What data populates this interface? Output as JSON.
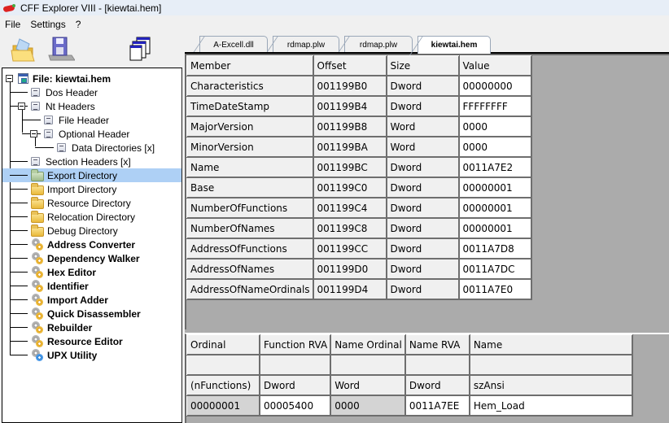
{
  "window": {
    "title": "CFF Explorer VIII - [kiewtai.hem]"
  },
  "menu": [
    "File",
    "Settings",
    "?"
  ],
  "toolbar": [
    {
      "name": "open-icon"
    },
    {
      "name": "save-icon"
    },
    {
      "name": "windows-icon"
    }
  ],
  "tree": {
    "root": "File: kiewtai.hem",
    "items": [
      {
        "label": "Dos Header",
        "icon": "doc",
        "level": 1
      },
      {
        "label": "Nt Headers",
        "icon": "doc",
        "level": 1,
        "expanded": true
      },
      {
        "label": "File Header",
        "icon": "doc",
        "level": 2
      },
      {
        "label": "Optional Header",
        "icon": "doc",
        "level": 2,
        "expanded": true
      },
      {
        "label": "Data Directories [x]",
        "icon": "doc",
        "level": 3
      },
      {
        "label": "Section Headers [x]",
        "icon": "doc",
        "level": 1
      },
      {
        "label": "Export Directory",
        "icon": "folder-green",
        "level": 1,
        "selected": true
      },
      {
        "label": "Import Directory",
        "icon": "folder",
        "level": 1
      },
      {
        "label": "Resource Directory",
        "icon": "folder",
        "level": 1
      },
      {
        "label": "Relocation Directory",
        "icon": "folder",
        "level": 1
      },
      {
        "label": "Debug Directory",
        "icon": "folder",
        "level": 1
      },
      {
        "label": "Address Converter",
        "icon": "gear",
        "level": 1,
        "bold": true
      },
      {
        "label": "Dependency Walker",
        "icon": "gear",
        "level": 1,
        "bold": true
      },
      {
        "label": "Hex Editor",
        "icon": "gear",
        "level": 1,
        "bold": true
      },
      {
        "label": "Identifier",
        "icon": "gear",
        "level": 1,
        "bold": true
      },
      {
        "label": "Import Adder",
        "icon": "gear",
        "level": 1,
        "bold": true
      },
      {
        "label": "Quick Disassembler",
        "icon": "gear",
        "level": 1,
        "bold": true
      },
      {
        "label": "Rebuilder",
        "icon": "gear",
        "level": 1,
        "bold": true
      },
      {
        "label": "Resource Editor",
        "icon": "gear",
        "level": 1,
        "bold": true
      },
      {
        "label": "UPX Utility",
        "icon": "gear-blue",
        "level": 1,
        "bold": true
      }
    ]
  },
  "tabs": [
    {
      "label": "A-Excell.dll",
      "active": false
    },
    {
      "label": "rdmap.plw",
      "active": false
    },
    {
      "label": "rdmap.plw",
      "active": false
    },
    {
      "label": "kiewtai.hem",
      "active": true
    }
  ],
  "members_table": {
    "headers": [
      "Member",
      "Offset",
      "Size",
      "Value"
    ],
    "rows": [
      [
        "Characteristics",
        "001199B0",
        "Dword",
        "00000000"
      ],
      [
        "TimeDateStamp",
        "001199B4",
        "Dword",
        "FFFFFFFF"
      ],
      [
        "MajorVersion",
        "001199B8",
        "Word",
        "0000"
      ],
      [
        "MinorVersion",
        "001199BA",
        "Word",
        "0000"
      ],
      [
        "Name",
        "001199BC",
        "Dword",
        "0011A7E2"
      ],
      [
        "Base",
        "001199C0",
        "Dword",
        "00000001"
      ],
      [
        "NumberOfFunctions",
        "001199C4",
        "Dword",
        "00000001"
      ],
      [
        "NumberOfNames",
        "001199C8",
        "Dword",
        "00000001"
      ],
      [
        "AddressOfFunctions",
        "001199CC",
        "Dword",
        "0011A7D8"
      ],
      [
        "AddressOfNames",
        "001199D0",
        "Dword",
        "0011A7DC"
      ],
      [
        "AddressOfNameOrdinals",
        "001199D4",
        "Dword",
        "0011A7E0"
      ]
    ]
  },
  "exports_table": {
    "headers": [
      "Ordinal",
      "Function RVA",
      "Name Ordinal",
      "Name RVA",
      "Name"
    ],
    "subheaders": [
      "",
      "",
      "",
      "",
      ""
    ],
    "types": [
      "(nFunctions)",
      "Dword",
      "Word",
      "Dword",
      "szAnsi"
    ],
    "rows": [
      [
        "00000001",
        "00005400",
        "0000",
        "0011A7EE",
        "Hem_Load"
      ]
    ]
  }
}
